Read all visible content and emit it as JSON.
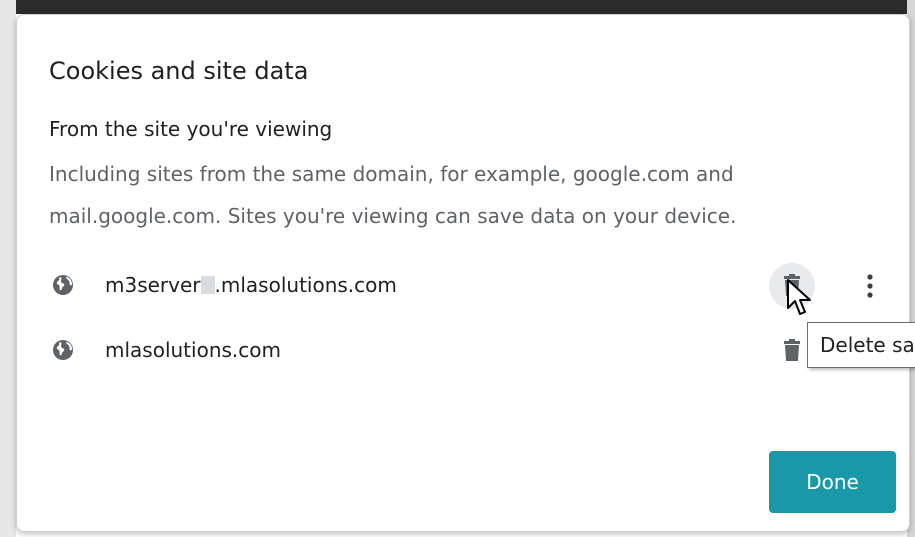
{
  "dialog": {
    "title": "Cookies and site data",
    "section_title": "From the site you're viewing",
    "section_description": "Including sites from the same domain, for example, google.com and mail.google.com. Sites you're viewing can save data on your device."
  },
  "sites": [
    {
      "prefix": "m3server",
      "suffix": ".mlasolutions.com",
      "icon": "globe-icon",
      "delete_icon": "trash-icon",
      "more_icon": "more-vert-icon",
      "hovered": true
    },
    {
      "label": "mlasolutions.com",
      "icon": "globe-icon",
      "delete_icon": "trash-icon"
    }
  ],
  "tooltip": {
    "text": "Delete sa"
  },
  "actions": {
    "done_label": "Done"
  },
  "colors": {
    "accent": "#1a98a9",
    "text_primary": "#202124",
    "text_secondary": "#5f6368",
    "hover_bg": "#e9eaed"
  }
}
